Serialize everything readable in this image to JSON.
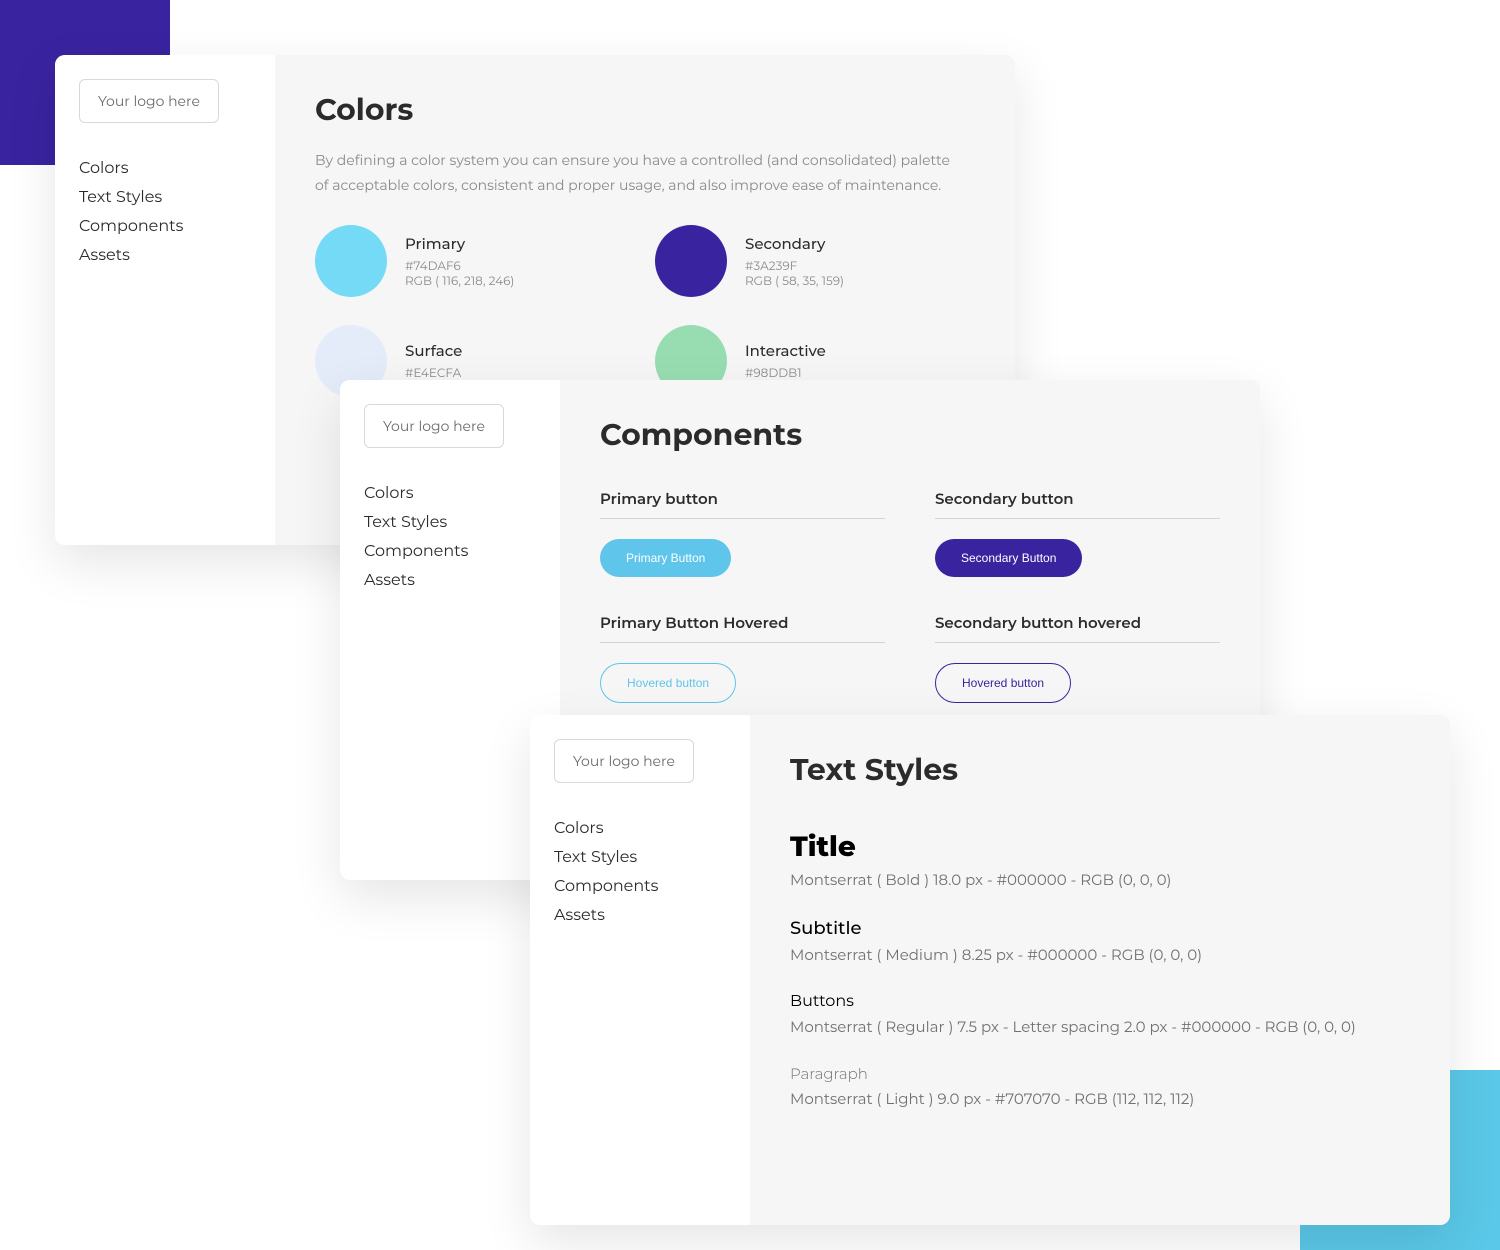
{
  "decor": {
    "purple": "#3A239F",
    "cyan": "#5AC8E8"
  },
  "sidebar": {
    "logo_placeholder": "Your logo here",
    "items": [
      "Colors",
      "Text Styles",
      "Components",
      "Assets"
    ]
  },
  "colors_panel": {
    "title": "Colors",
    "description": "By defining a color system you can ensure you have a controlled (and consolidated) palette of acceptable colors, consistent and proper usage, and also improve ease of maintenance.",
    "swatches": [
      {
        "name": "Primary",
        "hex": "#74DAF6",
        "rgb": "RGB ( 116, 218, 246)",
        "fill": "#74DAF6"
      },
      {
        "name": "Secondary",
        "hex": "#3A239F",
        "rgb": "RGB ( 58, 35, 159)",
        "fill": "#3A239F"
      },
      {
        "name": "Surface",
        "hex": "#E4ECFA",
        "rgb": "",
        "fill": "#E4ECFA"
      },
      {
        "name": "Interactive",
        "hex": "#98DDB1",
        "rgb": "",
        "fill": "#98DDB1"
      }
    ]
  },
  "components_panel": {
    "title": "Components",
    "blocks": [
      {
        "label": "Primary button",
        "button_text": "Primary Button",
        "style": "primary"
      },
      {
        "label": "Secondary button",
        "button_text": "Secondary Button",
        "style": "secondary"
      },
      {
        "label": "Primary Button Hovered",
        "button_text": "Hovered button",
        "style": "outline-primary"
      },
      {
        "label": "Secondary button hovered",
        "button_text": "Hovered button",
        "style": "outline-secondary"
      }
    ]
  },
  "text_panel": {
    "title": "Text Styles",
    "styles": [
      {
        "sample": "Title",
        "meta": "Montserrat ( Bold ) 18.0 px  - #000000 - RGB (0, 0, 0)",
        "cls": "ts-title"
      },
      {
        "sample": "Subtitle",
        "meta": "Montserrat ( Medium ) 8.25 px  - #000000 - RGB (0, 0, 0)",
        "cls": "ts-subtitle"
      },
      {
        "sample": "Buttons",
        "meta": "Montserrat ( Regular ) 7.5 px - Letter spacing 2.0 px - #000000 - RGB (0, 0, 0)",
        "cls": "ts-buttons"
      },
      {
        "sample": "Paragraph",
        "meta": "Montserrat ( Light ) 9.0 px  - #707070 - RGB (112, 112, 112)",
        "cls": "ts-paragraph"
      }
    ]
  }
}
